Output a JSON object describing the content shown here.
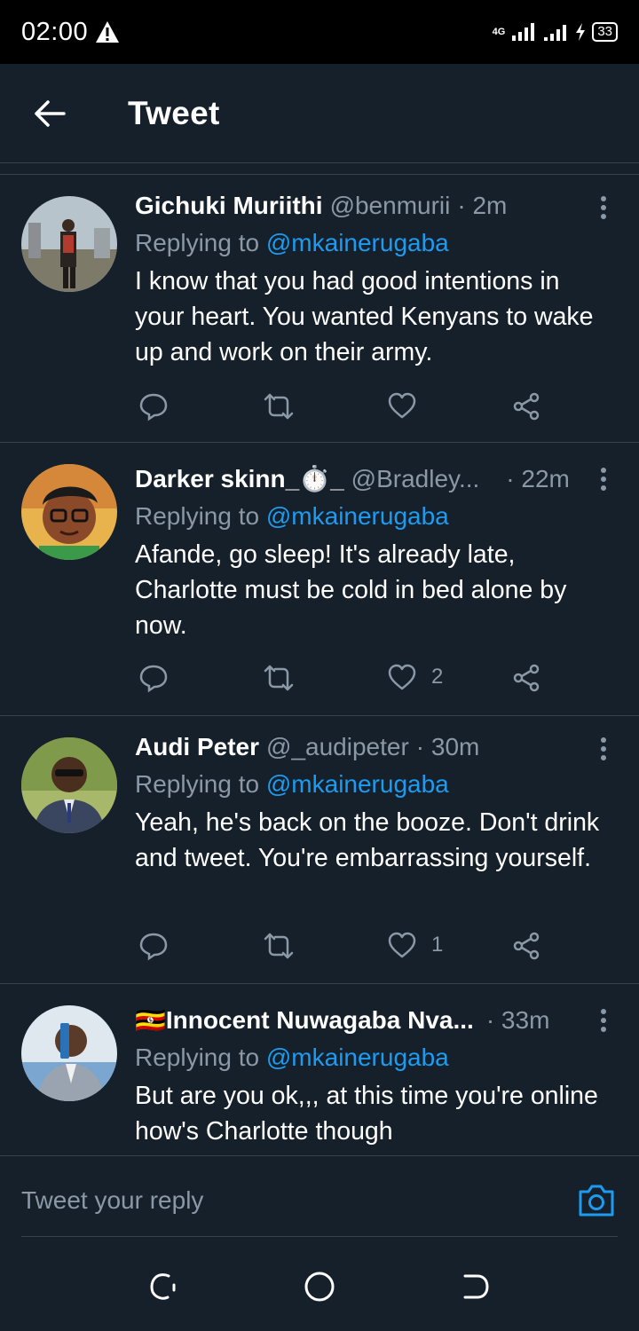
{
  "status_bar": {
    "time": "02:00",
    "network": "4G",
    "battery": "33",
    "warning_icon": "warning-triangle-icon"
  },
  "header": {
    "title": "Tweet",
    "back_icon": "arrow-left-icon"
  },
  "tweets": [
    {
      "name": "Gichuki Muriithi",
      "handle": "@benmurii",
      "time": "· 2m",
      "replying_prefix": "Replying to ",
      "replying_to": "@mkainerugaba",
      "text": "I know that you had good intentions in your heart. You wanted Kenyans to wake up and work on their army.",
      "like_count": ""
    },
    {
      "name": "Darker skinn_⏱️_",
      "handle": "@Bradley...",
      "time": "· 22m",
      "replying_prefix": "Replying to ",
      "replying_to": "@mkainerugaba",
      "text": "Afande, go sleep! It's already late, Charlotte must be cold in bed alone by now.",
      "like_count": "2"
    },
    {
      "name": "Audi Peter",
      "handle": "@_audipeter",
      "time": "· 30m",
      "replying_prefix": "Replying to ",
      "replying_to": "@mkainerugaba",
      "text": "Yeah,  he's back on the booze. Don't drink and tweet. You're embarrassing yourself.",
      "like_count": "1"
    },
    {
      "name": "🇺🇬Innocent Nuwagaba Nva...",
      "handle": "",
      "time": "· 33m",
      "replying_prefix": "Replying to ",
      "replying_to": "@mkainerugaba",
      "text": "But are you ok,,, at this time you're online how's Charlotte though",
      "like_count": ""
    }
  ],
  "reply_bar": {
    "placeholder": "Tweet your reply",
    "camera_icon": "camera-icon"
  },
  "colors": {
    "background": "#15202b",
    "accent": "#1d9bf0",
    "muted": "#8b98a5",
    "divider": "#38444d"
  }
}
